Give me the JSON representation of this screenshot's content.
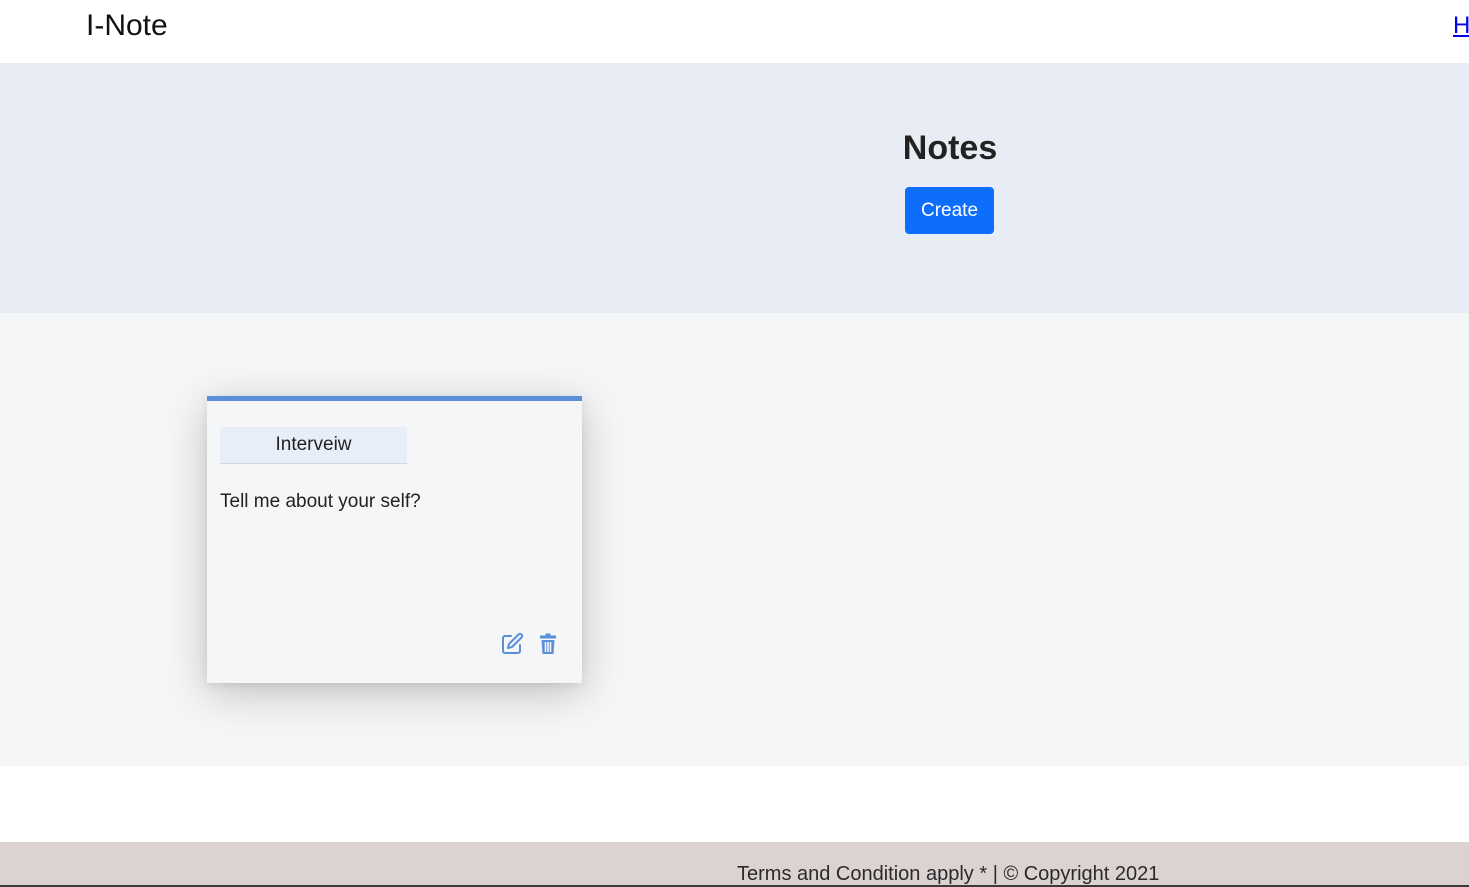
{
  "navbar": {
    "brand": "I-Note",
    "link_label": "H"
  },
  "hero": {
    "title": "Notes",
    "create_label": "Create"
  },
  "notes": [
    {
      "title": "Interveiw",
      "body": "Tell me about your self?",
      "actions": [
        "edit-icon",
        "trash-icon"
      ]
    }
  ],
  "footer": {
    "text": "Terms and Condition apply * | © Copyright 2021"
  },
  "colors": {
    "accent": "#0d6efd",
    "card_border": "#5b8fdb",
    "hero_bg": "#e8ecf4",
    "footer_bg": "#dcd2d2"
  }
}
